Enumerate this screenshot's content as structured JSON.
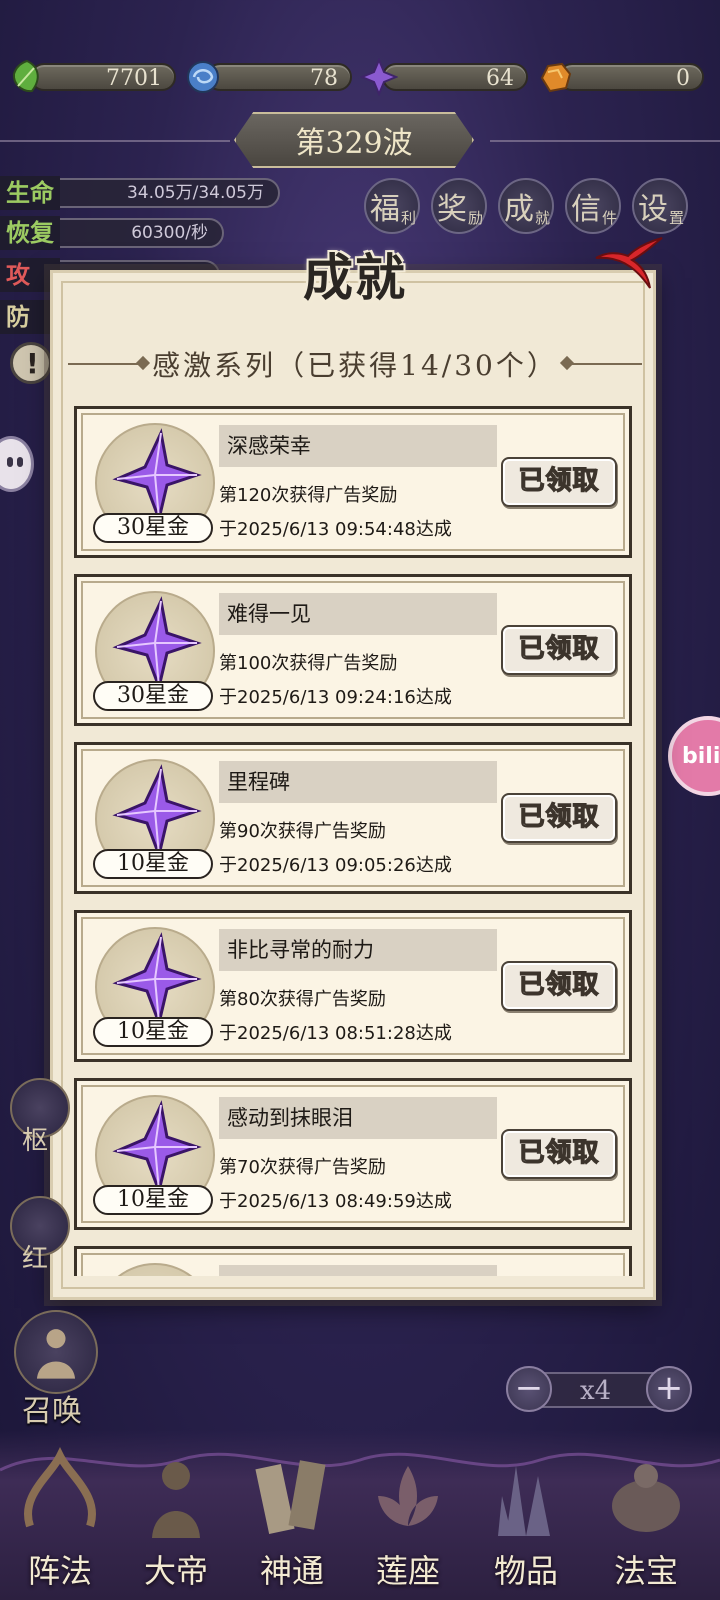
{
  "resources": [
    {
      "icon": "green-leaf-icon",
      "value": "7701",
      "color": "#5fae3e"
    },
    {
      "icon": "blue-orb-icon",
      "value": "78",
      "color": "#4a7fc8"
    },
    {
      "icon": "purple-crystal-icon",
      "value": "64",
      "color": "#8a5ad0"
    },
    {
      "icon": "orange-ore-icon",
      "value": "0",
      "color": "#e08a2a"
    }
  ],
  "wave": {
    "label": "第329波"
  },
  "stats": [
    {
      "label": "生命",
      "value": "34.05万/34.05万"
    },
    {
      "label": "恢复",
      "value": "60300/秒"
    },
    {
      "label": "攻",
      "value": ""
    },
    {
      "label": "防",
      "value": ""
    }
  ],
  "menu": [
    {
      "big": "福",
      "small": "利"
    },
    {
      "big": "奖",
      "small": "励"
    },
    {
      "big": "成",
      "small": "就"
    },
    {
      "big": "信",
      "small": "件"
    },
    {
      "big": "设",
      "small": "置"
    }
  ],
  "modal": {
    "title": "成就",
    "series": "感激系列（已获得14/30个）",
    "achievements": [
      {
        "name": "深感荣幸",
        "reward": "30星金",
        "condition": "第120次获得广告奖励",
        "date": "于2025/6/13 09:54:48达成",
        "status": "已领取"
      },
      {
        "name": "难得一见",
        "reward": "30星金",
        "condition": "第100次获得广告奖励",
        "date": "于2025/6/13 09:24:16达成",
        "status": "已领取"
      },
      {
        "name": "里程碑",
        "reward": "10星金",
        "condition": "第90次获得广告奖励",
        "date": "于2025/6/13 09:05:26达成",
        "status": "已领取"
      },
      {
        "name": "非比寻常的耐力",
        "reward": "10星金",
        "condition": "第80次获得广告奖励",
        "date": "于2025/6/13 08:51:28达成",
        "status": "已领取"
      },
      {
        "name": "感动到抹眼泪",
        "reward": "10星金",
        "condition": "第70次获得广告奖励",
        "date": "于2025/6/13 08:49:59达成",
        "status": "已领取"
      },
      {
        "name": "",
        "reward": "",
        "condition": "",
        "date": "",
        "status": ""
      }
    ]
  },
  "summon": {
    "label": "召唤"
  },
  "speed": {
    "value": "x4",
    "minus": "−",
    "plus": "+"
  },
  "nav": [
    {
      "label": "阵法"
    },
    {
      "label": "大帝"
    },
    {
      "label": "神通"
    },
    {
      "label": "莲座"
    },
    {
      "label": "物品"
    },
    {
      "label": "法宝"
    }
  ],
  "side": {
    "left_label": "枢",
    "left_label2": "红"
  }
}
